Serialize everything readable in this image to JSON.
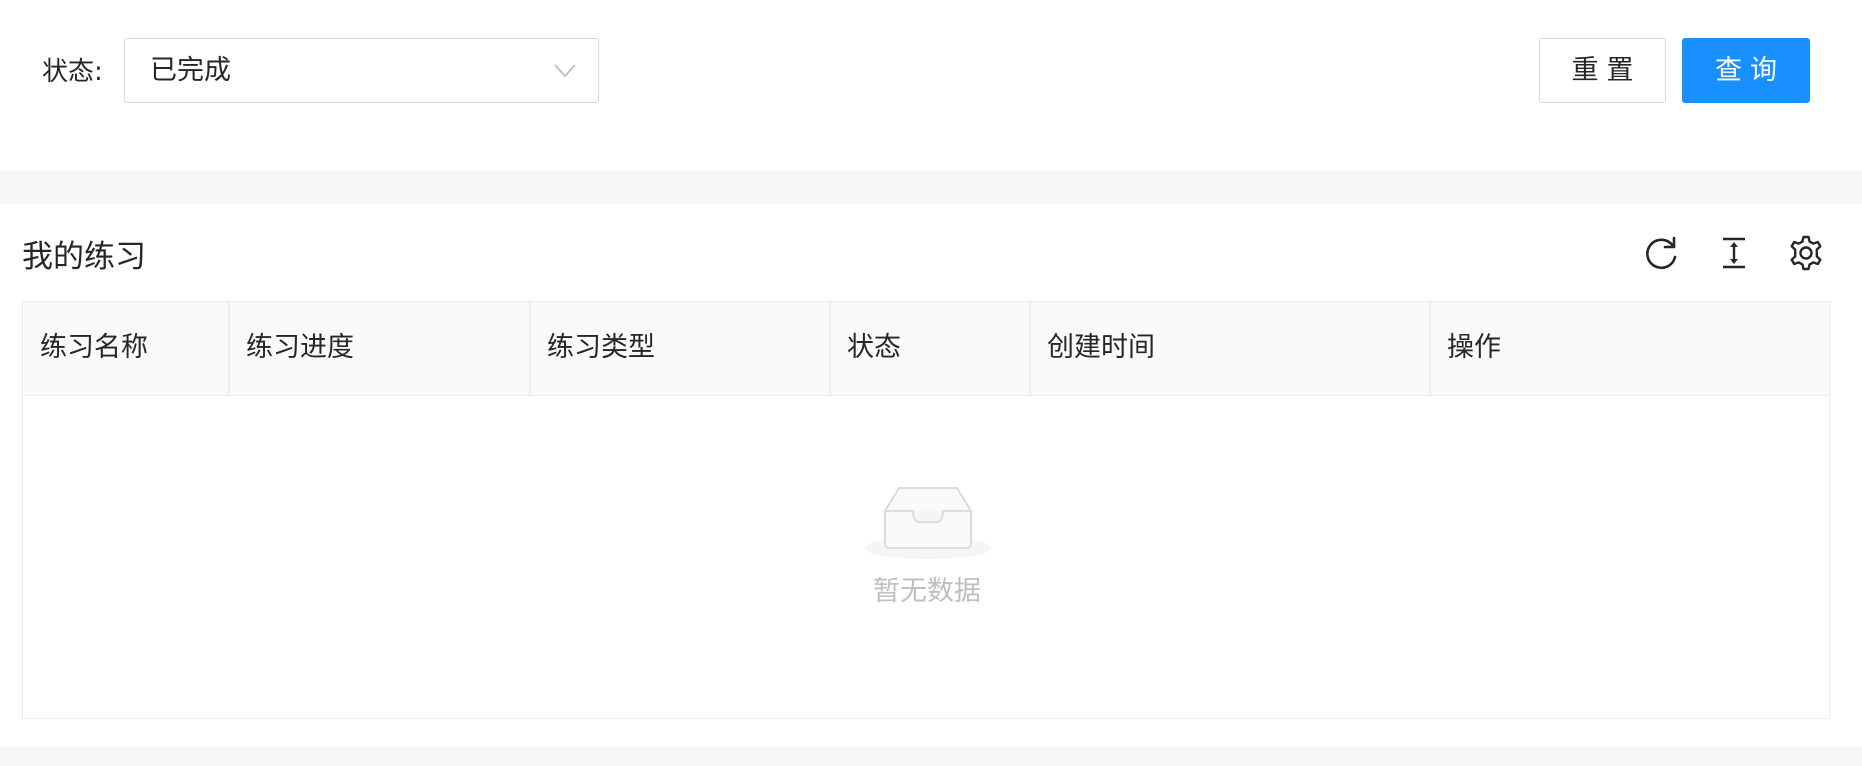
{
  "filter": {
    "status_label": "状态:",
    "status_value": "已完成"
  },
  "buttons": {
    "reset_label": "重置",
    "query_label": "查询"
  },
  "card": {
    "title": "我的练习"
  },
  "toolbar": {
    "icons": [
      "reload-icon",
      "column-height-icon",
      "setting-icon"
    ]
  },
  "table": {
    "columns": [
      "练习名称",
      "练习进度",
      "练习类型",
      "状态",
      "创建时间",
      "操作"
    ],
    "rows": [],
    "empty_text": "暂无数据"
  },
  "colors": {
    "primary": "#1890ff",
    "border": "#d9d9d9",
    "page_background": "#f5f6f8",
    "empty_text": "#bfbfbf"
  }
}
